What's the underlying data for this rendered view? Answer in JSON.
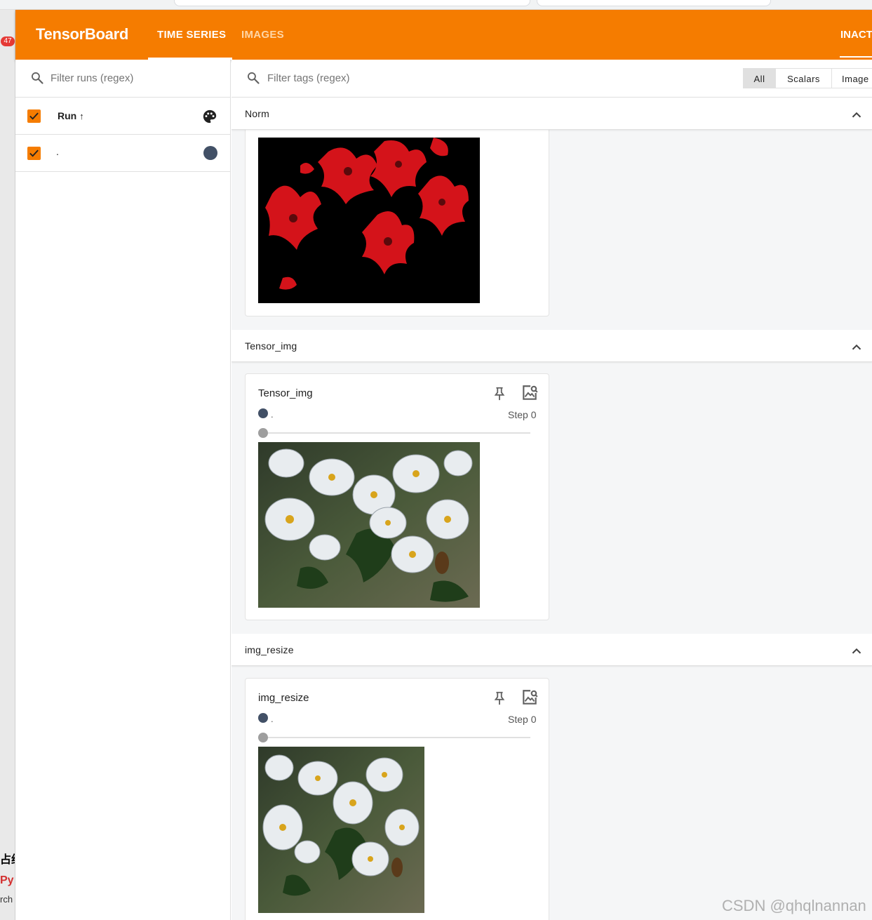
{
  "header": {
    "brand": "TensorBoard",
    "tabs": [
      {
        "label": "TIME SERIES",
        "active": true
      },
      {
        "label": "IMAGES",
        "active": false
      }
    ],
    "inactive_label": "INACT"
  },
  "sidebar": {
    "filter_placeholder": "Filter runs (regex)",
    "column_label": "Run",
    "sort_indicator": "↑",
    "runs": [
      {
        "label": ".",
        "color": "#425066",
        "checked": true
      }
    ]
  },
  "main": {
    "filter_placeholder": "Filter tags (regex)",
    "type_toggles": [
      "All",
      "Scalars",
      "Image"
    ],
    "selected_toggle": "All",
    "groups": [
      {
        "title": "Norm"
      },
      {
        "title": "Tensor_img",
        "card": {
          "title": "Tensor_img",
          "run_label": ".",
          "step": "Step 0"
        }
      },
      {
        "title": "img_resize",
        "card": {
          "title": "img_resize",
          "run_label": ".",
          "step": "Step 0"
        }
      }
    ]
  },
  "left_fragments": {
    "badge": "47",
    "frag1": "占约",
    "frag2": "Py",
    "frag3": "rch"
  },
  "watermark": "CSDN @qhqlnannan",
  "colors": {
    "header": "#f57c00",
    "run": "#425066"
  }
}
